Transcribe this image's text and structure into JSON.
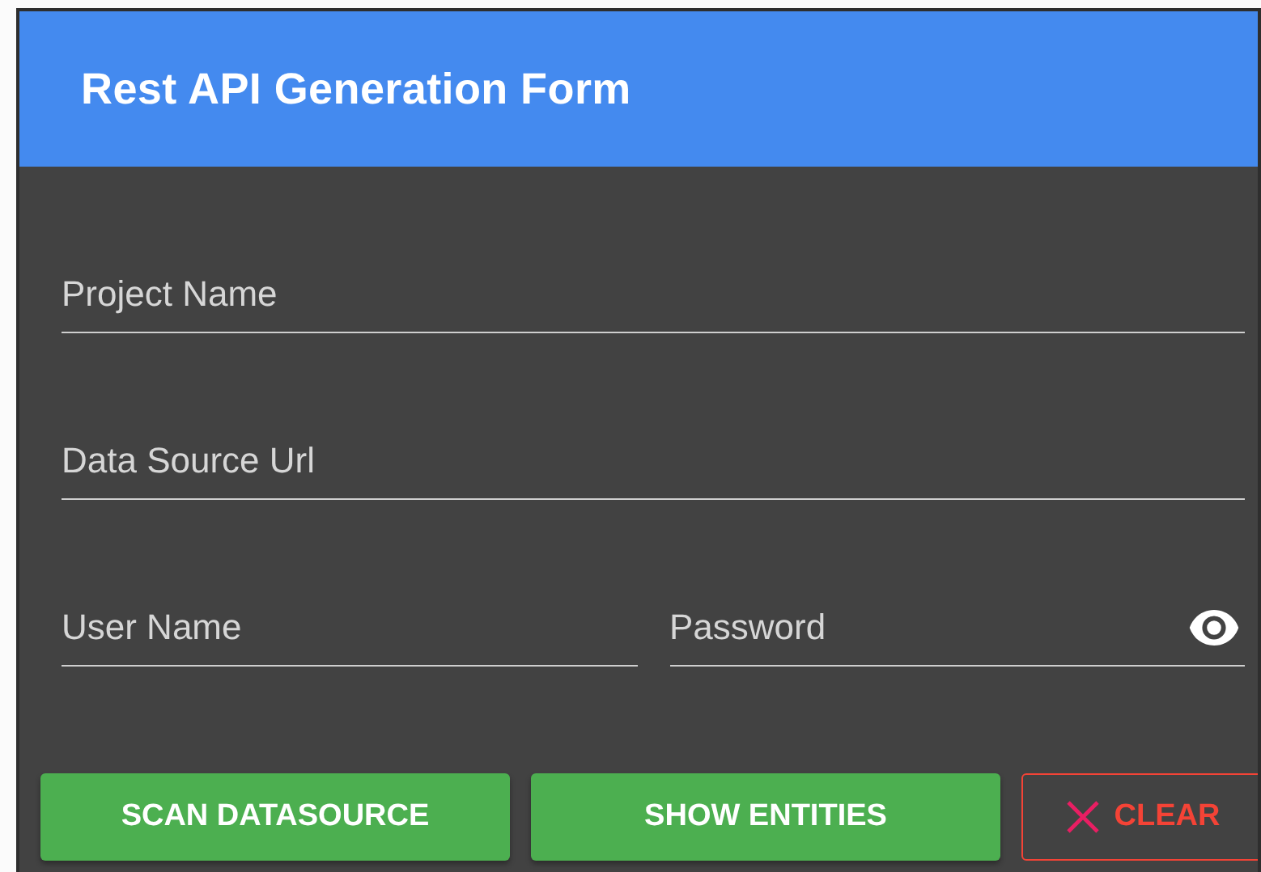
{
  "header": {
    "title": "Rest API Generation Form"
  },
  "field_rows": [
    {
      "fields": [
        {
          "kind": "text",
          "placeholder": "Project Name"
        }
      ]
    },
    {
      "fields": [
        {
          "kind": "text",
          "placeholder": "Data Source Url"
        }
      ]
    },
    {
      "fields": [
        {
          "kind": "text",
          "placeholder": "User Name"
        },
        {
          "kind": "password",
          "placeholder": "Password"
        }
      ]
    }
  ],
  "buttons": [
    {
      "kind": "filled",
      "label": "SCAN DATASOURCE"
    },
    {
      "kind": "filled",
      "label": "SHOW ENTITIES"
    },
    {
      "kind": "outlined",
      "label": "CLEAR"
    }
  ]
}
